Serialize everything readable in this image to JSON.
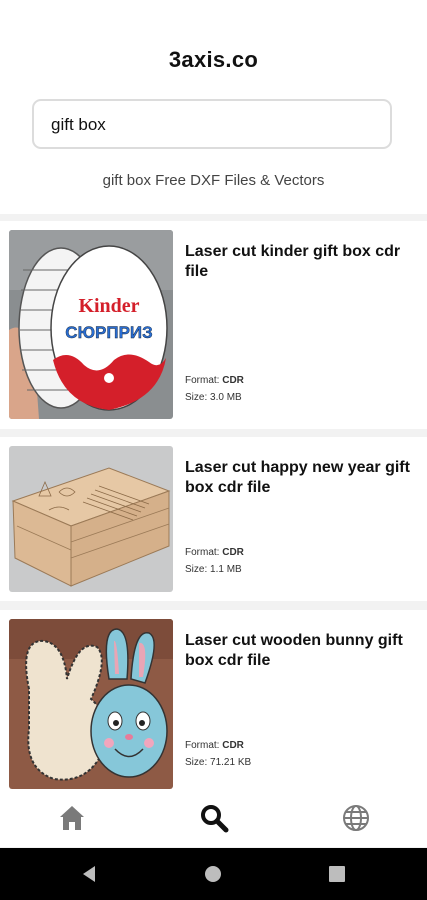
{
  "app": {
    "title": "3axis.co"
  },
  "search": {
    "value": "gift box"
  },
  "results_heading": "gift box Free DXF Files & Vectors",
  "results": [
    {
      "title": "Laser cut kinder gift box cdr file",
      "format_label": "Format:",
      "format": "CDR",
      "size_label": "Size:",
      "size": "3.0 MB",
      "thumb_text_top": "Kinder",
      "thumb_text_bottom": "СЮРПРИЗ"
    },
    {
      "title": "Laser cut happy new year gift box cdr file",
      "format_label": "Format:",
      "format": "CDR",
      "size_label": "Size:",
      "size": "1.1 MB"
    },
    {
      "title": "Laser cut wooden bunny gift box cdr file",
      "format_label": "Format:",
      "format": "CDR",
      "size_label": "Size:",
      "size": "71.21 KB"
    }
  ],
  "nav": [
    {
      "icon": "home-icon"
    },
    {
      "icon": "search-icon",
      "active": true
    },
    {
      "icon": "globe-icon"
    }
  ],
  "system_nav": [
    {
      "icon": "back-icon"
    },
    {
      "icon": "home-circle-icon"
    },
    {
      "icon": "recents-icon"
    }
  ],
  "colors": {
    "accent": "#222222",
    "inactive_icon": "#7a7a7a",
    "separator": "#f2f2f2",
    "system_bar": "#000000"
  }
}
